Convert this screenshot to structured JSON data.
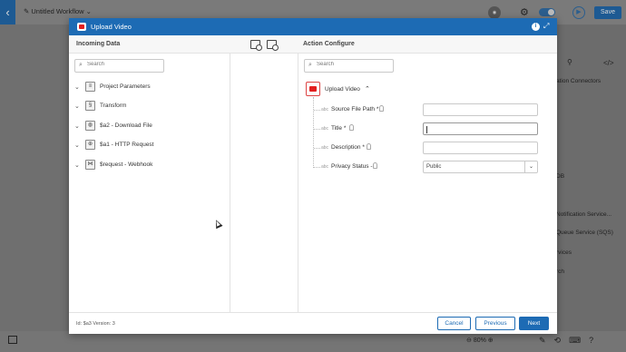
{
  "app": {
    "workflow_title": "Untitled Workflow",
    "save_label": "Save",
    "zoom": "80%",
    "right_panel_items": [
      "ation Connectors",
      "DB",
      "Notification Service...",
      "Queue Service (SQS)",
      "rvices",
      "rch"
    ]
  },
  "modal": {
    "title": "Upload Video",
    "incoming_label": "Incoming Data",
    "action_label": "Action Configure",
    "incoming_search_placeholder": "Search",
    "action_search_placeholder": "Search",
    "incoming_items": [
      {
        "label": "Project Parameters",
        "icon": "parameters-icon"
      },
      {
        "label": "Transform",
        "icon": "transform-icon"
      },
      {
        "label": "$a2 - Download File",
        "icon": "download-file-icon"
      },
      {
        "label": "$a1 - HTTP Request",
        "icon": "http-request-icon"
      },
      {
        "label": "$request - Webhook",
        "icon": "webhook-icon"
      }
    ],
    "action_root": "Upload Video",
    "fields": [
      {
        "label": "Source File Path",
        "required": "*",
        "value": ""
      },
      {
        "label": "Title",
        "required": "*",
        "value": ""
      },
      {
        "label": "Description",
        "required": "*",
        "value": ""
      },
      {
        "label": "Privacy Status",
        "required": "-",
        "value": "Public"
      }
    ],
    "footer_meta": "Id: $a3    Version: 3",
    "cancel_label": "Cancel",
    "previous_label": "Previous",
    "next_label": "Next",
    "accent_color": "#1d6bb4"
  }
}
